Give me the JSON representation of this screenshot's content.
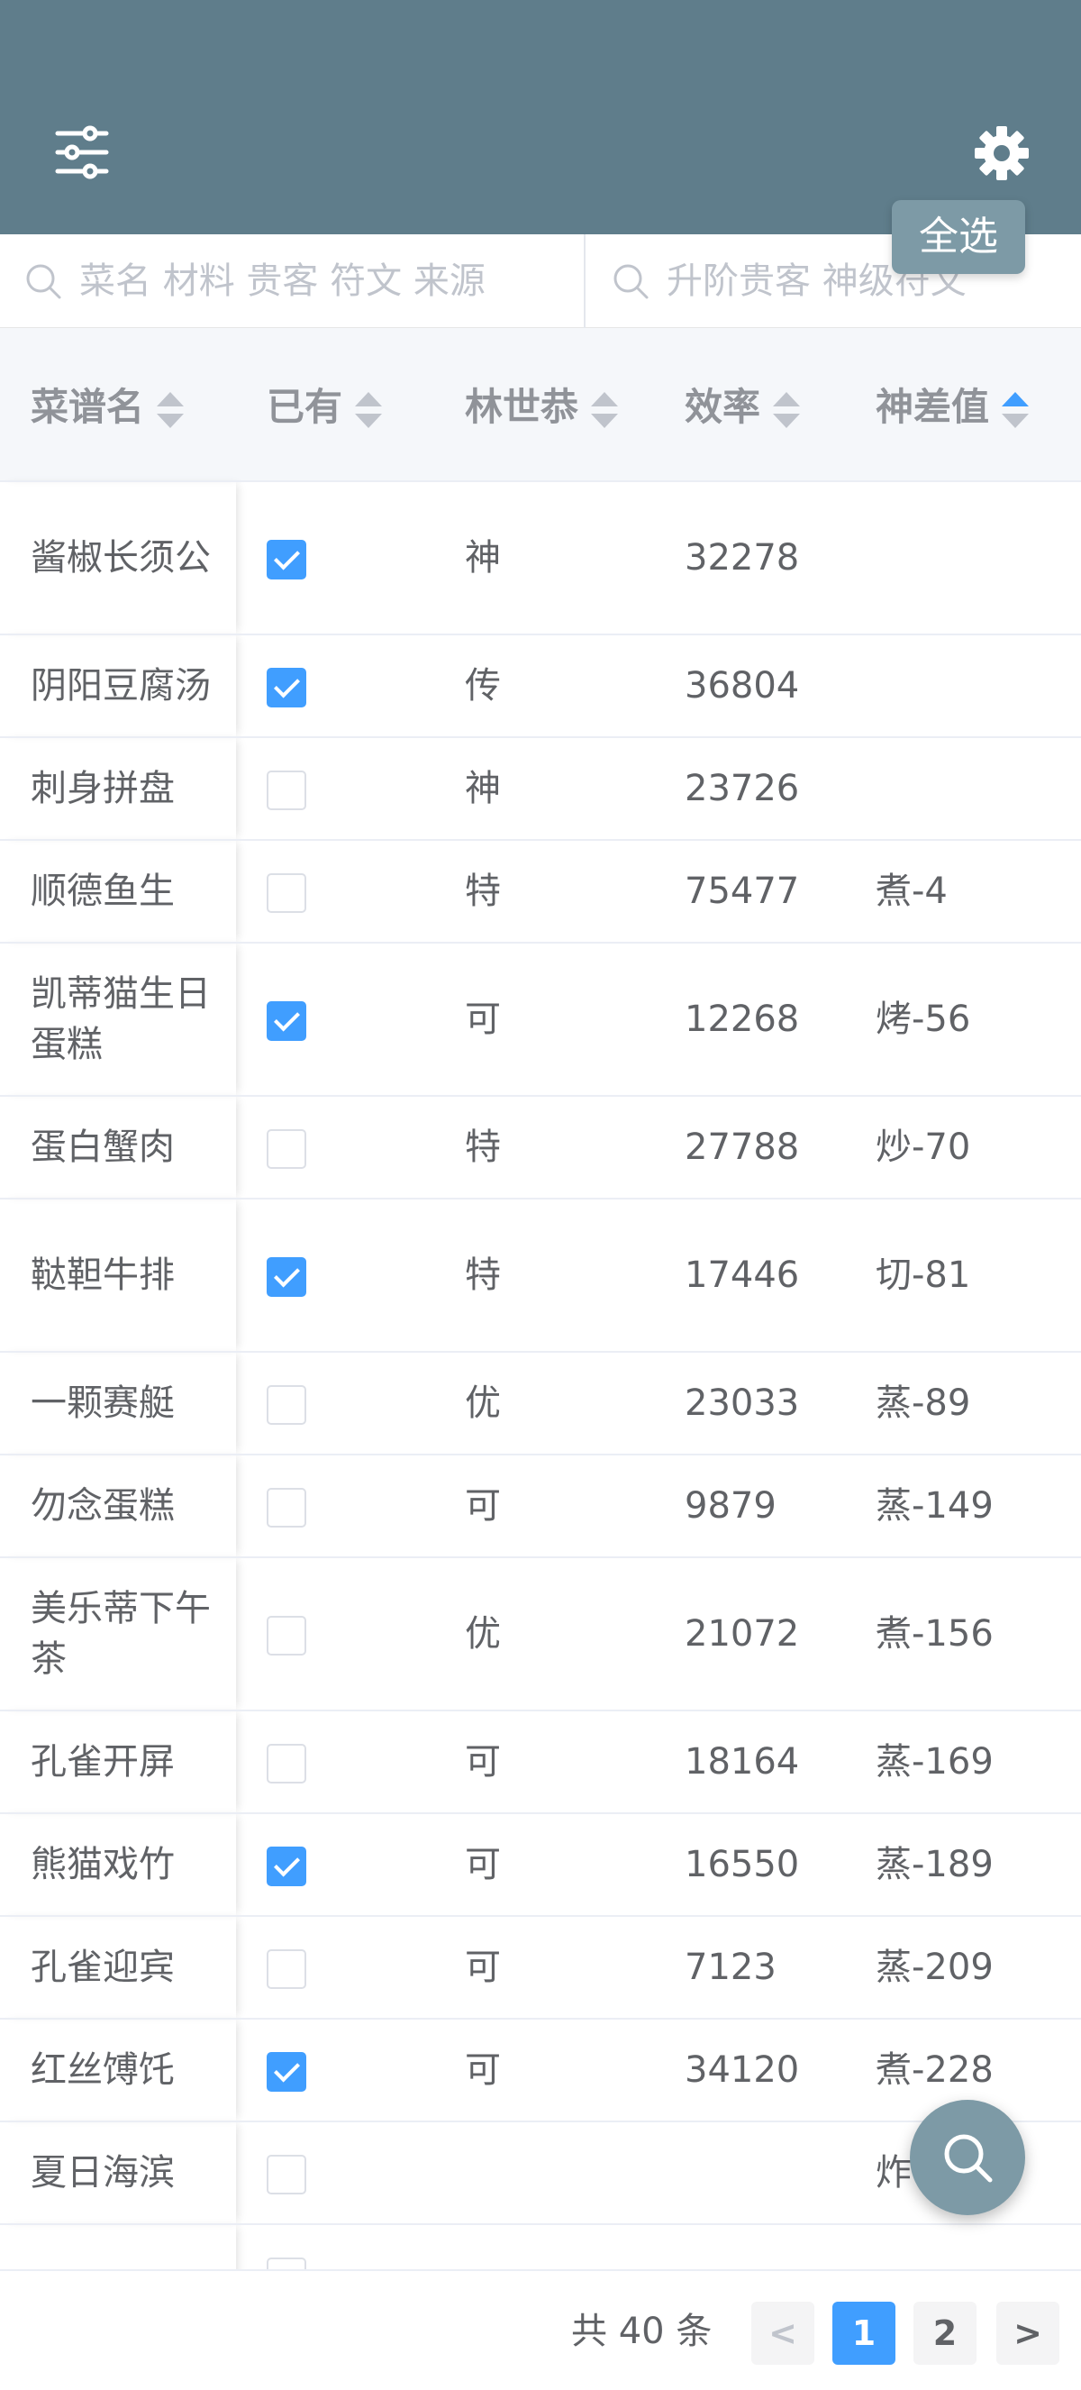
{
  "toolbar": {
    "select_all_label": "全选"
  },
  "search": {
    "primary_placeholder": "菜名 材料 贵客 符文 来源",
    "secondary_placeholder": "升阶贵客 神级符文"
  },
  "table": {
    "headers": [
      "菜谱名",
      "已有",
      "林世恭",
      "效率",
      "神差值"
    ],
    "rows": [
      {
        "name": "酱椒长须公",
        "owned": true,
        "rank": "神",
        "efficiency": "32278",
        "diff": ""
      },
      {
        "name": "阴阳豆腐汤",
        "owned": true,
        "rank": "传",
        "efficiency": "36804",
        "diff": ""
      },
      {
        "name": "刺身拼盘",
        "owned": false,
        "rank": "神",
        "efficiency": "23726",
        "diff": ""
      },
      {
        "name": "顺德鱼生",
        "owned": false,
        "rank": "特",
        "efficiency": "75477",
        "diff": "煮-4"
      },
      {
        "name": "凯蒂猫生日蛋糕",
        "owned": true,
        "rank": "可",
        "efficiency": "12268",
        "diff": "烤-56"
      },
      {
        "name": "蛋白蟹肉",
        "owned": false,
        "rank": "特",
        "efficiency": "27788",
        "diff": "炒-70"
      },
      {
        "name": "鞑靼牛排",
        "owned": true,
        "rank": "特",
        "efficiency": "17446",
        "diff": "切-81"
      },
      {
        "name": "一颗赛艇",
        "owned": false,
        "rank": "优",
        "efficiency": "23033",
        "diff": "蒸-89"
      },
      {
        "name": "勿念蛋糕",
        "owned": false,
        "rank": "可",
        "efficiency": "9879",
        "diff": "蒸-149"
      },
      {
        "name": "美乐蒂下午茶",
        "owned": false,
        "rank": "优",
        "efficiency": "21072",
        "diff": "煮-156"
      },
      {
        "name": "孔雀开屏",
        "owned": false,
        "rank": "可",
        "efficiency": "18164",
        "diff": "蒸-169"
      },
      {
        "name": "熊猫戏竹",
        "owned": true,
        "rank": "可",
        "efficiency": "16550",
        "diff": "蒸-189"
      },
      {
        "name": "孔雀迎宾",
        "owned": false,
        "rank": "可",
        "efficiency": "7123",
        "diff": "蒸-209"
      },
      {
        "name": "红丝馎饦",
        "owned": true,
        "rank": "可",
        "efficiency": "34120",
        "diff": "煮-228"
      },
      {
        "name": "夏日海滨",
        "owned": false,
        "rank": "",
        "efficiency": "",
        "diff": "炸"
      }
    ]
  },
  "pagination": {
    "total_label": "共 40 条",
    "pages": [
      "1",
      "2"
    ],
    "current": "1",
    "prev": "<",
    "next": ">"
  },
  "colors": {
    "header_bg": "#5f7d8b",
    "accent": "#409eff",
    "fab_bg": "#7d9aa6"
  }
}
